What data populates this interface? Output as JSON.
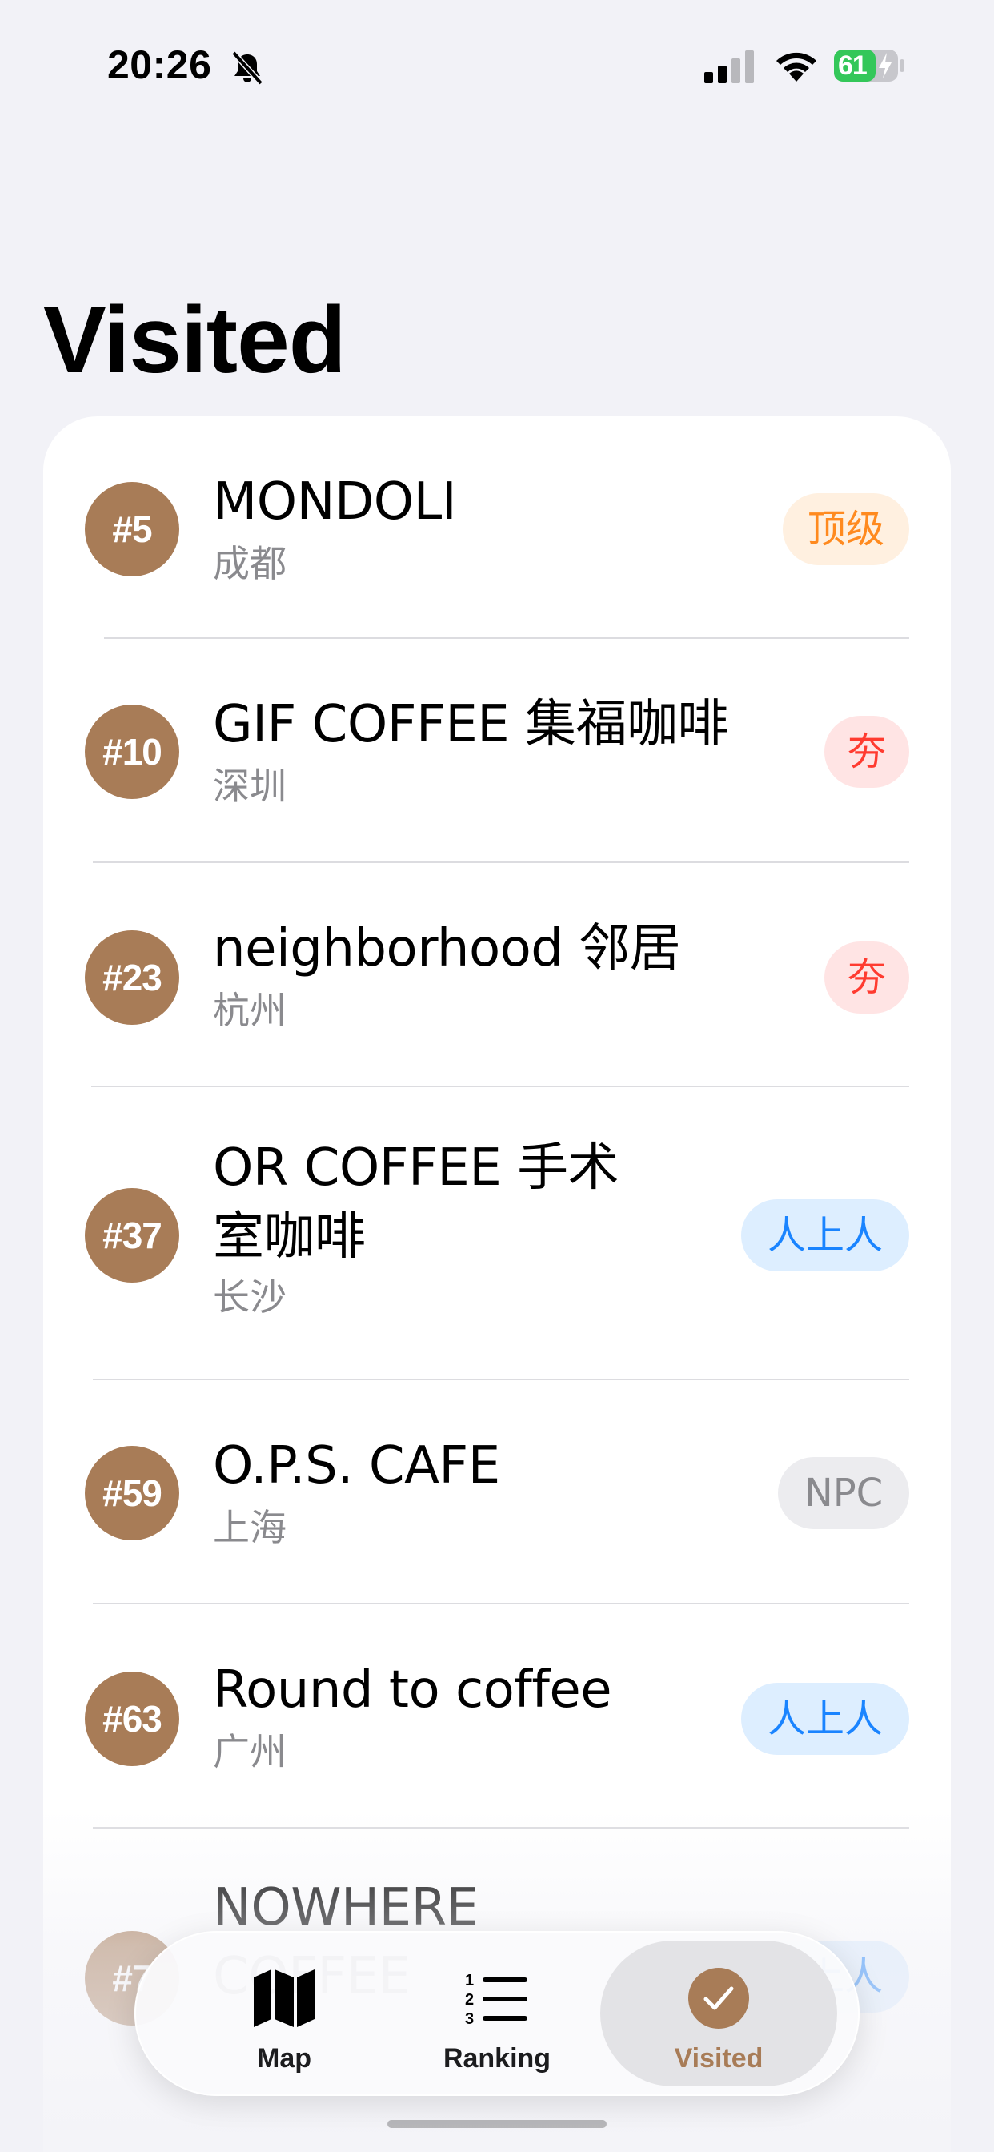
{
  "status_bar": {
    "time": "20:26",
    "battery": "61",
    "icons": [
      "bell-slash-icon",
      "cellular-signal-icon",
      "wifi-icon",
      "battery-charging-icon"
    ]
  },
  "page": {
    "title": "Visited"
  },
  "visited": [
    {
      "rank": "#5",
      "name": "MONDOLI",
      "city": "成都",
      "tier": "顶级"
    },
    {
      "rank": "#10",
      "name": "GIF COFFEE 集福咖啡",
      "city": "深圳",
      "tier": "夯"
    },
    {
      "rank": "#23",
      "name": "neighborhood 邻居",
      "city": "杭州",
      "tier": "夯"
    },
    {
      "rank": "#37",
      "name": "OR COFFEE 手术\n室咖啡",
      "city": "长沙",
      "tier": "人上人"
    },
    {
      "rank": "#59",
      "name": "O.P.S. CAFE",
      "city": "上海",
      "tier": "NPC"
    },
    {
      "rank": "#63",
      "name": "Round to coffee",
      "city": "广州",
      "tier": "人上人"
    },
    {
      "rank": "#7",
      "name": "NOWHERE\nCOFFEE",
      "city": "",
      "tier": "人上人"
    }
  ],
  "tier_colors": {
    "顶级": "#ff8a1f",
    "夯": "#ff3b30",
    "人上人": "#1a84ff",
    "NPC": "#8a8a8e"
  },
  "accent_color": "#a87c57",
  "tab_bar": {
    "tabs": [
      {
        "label": "Map",
        "icon": "map-icon",
        "active": false
      },
      {
        "label": "Ranking",
        "icon": "numbered-list-icon",
        "active": false
      },
      {
        "label": "Visited",
        "icon": "checkmark-circle-icon",
        "active": true
      }
    ]
  }
}
